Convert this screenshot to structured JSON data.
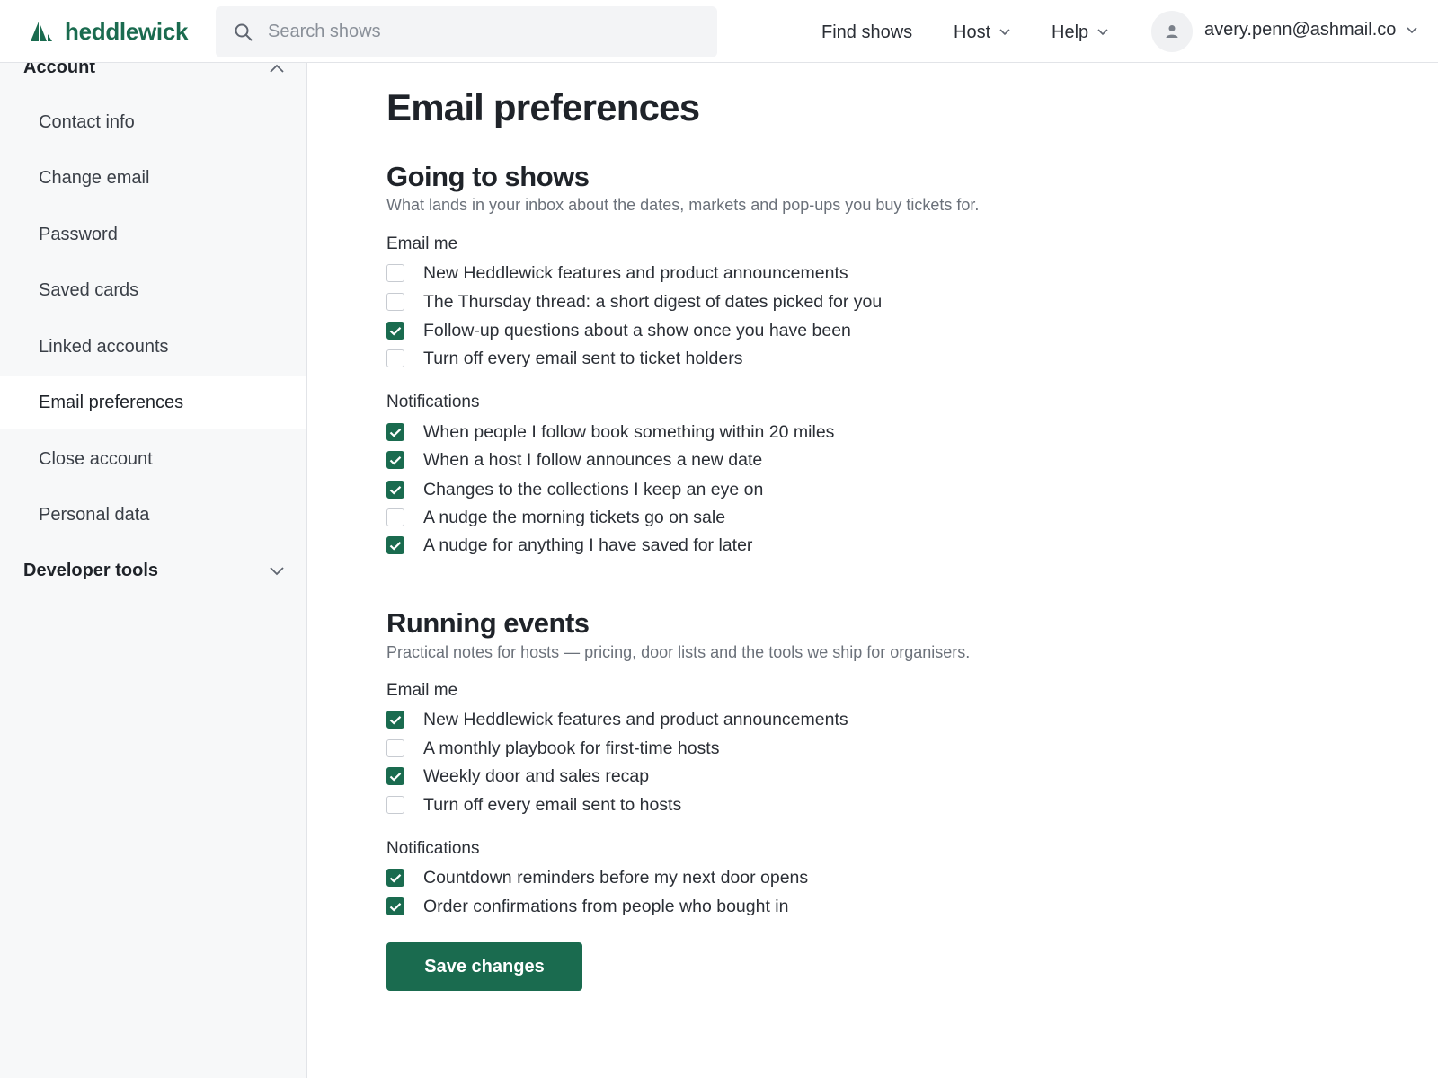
{
  "brand": {
    "name": "heddlewick",
    "accent": "#1a6b4f"
  },
  "search": {
    "placeholder": "Search shows",
    "value": ""
  },
  "nav": {
    "find_shows": "Find shows",
    "host": "Host",
    "help": "Help"
  },
  "user": {
    "email": "avery.penn@ashmail.co"
  },
  "sidebar": {
    "account_label": "Account",
    "items": [
      {
        "label": "Contact info"
      },
      {
        "label": "Change email"
      },
      {
        "label": "Password"
      },
      {
        "label": "Saved cards"
      },
      {
        "label": "Linked accounts"
      },
      {
        "label": "Email preferences",
        "active": true
      },
      {
        "label": "Close account"
      },
      {
        "label": "Personal data"
      }
    ],
    "dev_tools_label": "Developer tools"
  },
  "page": {
    "title": "Email preferences"
  },
  "sections": [
    {
      "title": "Going to shows",
      "description": "What lands in your inbox about the dates, markets and pop-ups you buy tickets for.",
      "email_label": "Email me",
      "email_options": [
        {
          "label": "New Heddlewick features and product announcements",
          "checked": false
        },
        {
          "label": "The Thursday thread: a short digest of dates picked for you",
          "checked": false
        },
        {
          "label": "Follow-up questions about a show once you have been",
          "checked": true
        },
        {
          "label": "Turn off every email sent to ticket holders",
          "checked": false
        }
      ],
      "notif_label": "Notifications",
      "notif_options": [
        {
          "label": "When people I follow book something within 20 miles",
          "checked": true
        },
        {
          "label": "When a host I follow announces a new date",
          "checked": true
        },
        {
          "label": "Changes to the collections I keep an eye on",
          "checked": true
        },
        {
          "label": "A nudge the morning tickets go on sale",
          "checked": false
        },
        {
          "label": "A nudge for anything I have saved for later",
          "checked": true
        }
      ]
    },
    {
      "title": "Running events",
      "description": "Practical notes for hosts — pricing, door lists and the tools we ship for organisers.",
      "email_label": "Email me",
      "email_options": [
        {
          "label": "New Heddlewick features and product announcements",
          "checked": true
        },
        {
          "label": "A monthly playbook for first-time hosts",
          "checked": false
        },
        {
          "label": "Weekly door and sales recap",
          "checked": true
        },
        {
          "label": "Turn off every email sent to hosts",
          "checked": false
        }
      ],
      "notif_label": "Notifications",
      "notif_options": [
        {
          "label": "Countdown reminders before my next door opens",
          "checked": true
        },
        {
          "label": "Order confirmations from people who bought in",
          "checked": true
        }
      ]
    }
  ],
  "save_label": "Save changes"
}
